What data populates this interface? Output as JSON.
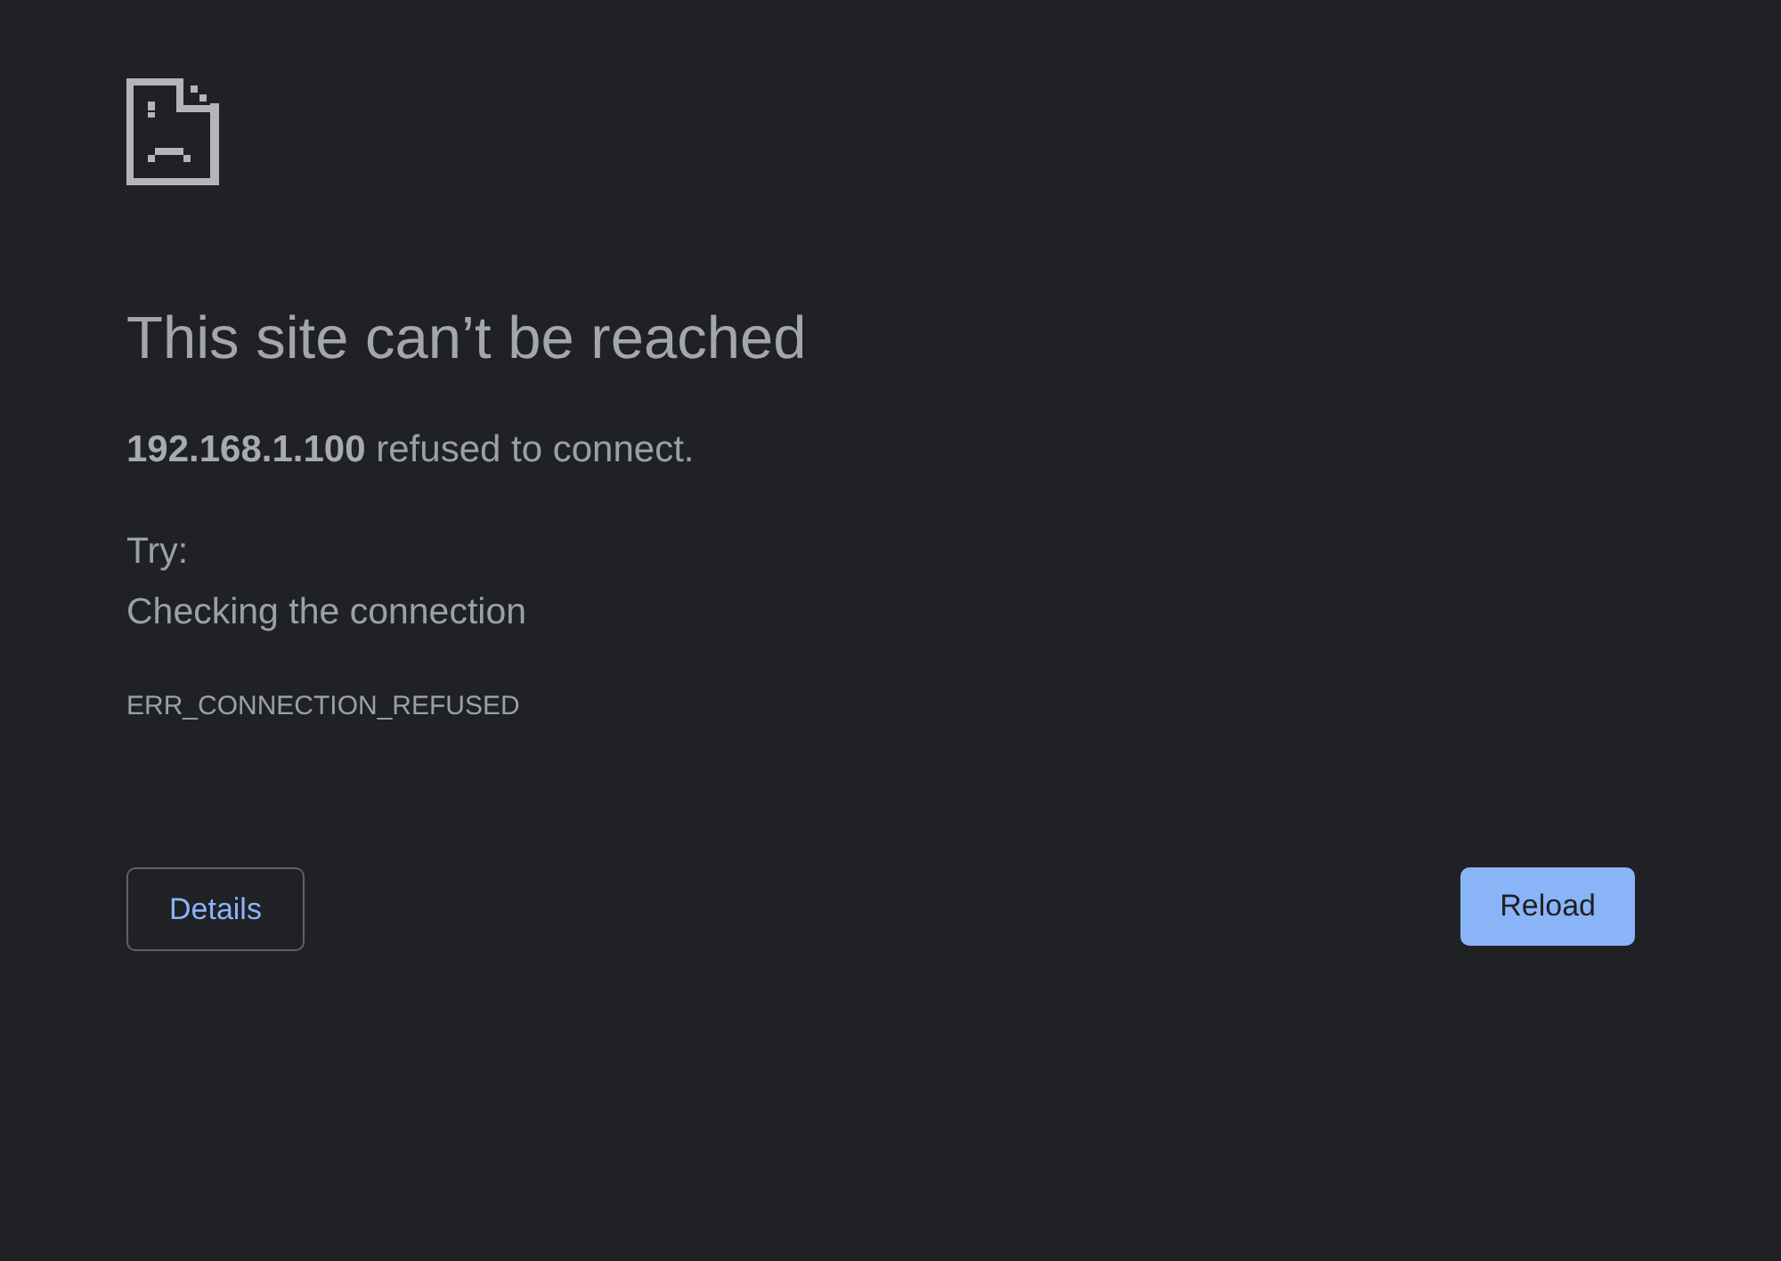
{
  "heading": "This site can’t be reached",
  "message": "**192.168.1.100** refused to connect.",
  "suggestions_heading": "Try:",
  "suggestions": [
    "Checking the connection"
  ],
  "error_code": "ERR_CONNECTION_REFUSED",
  "buttons": [
    {
      "label": "Details",
      "kind": "secondary"
    },
    {
      "label": "Reload",
      "kind": "primary"
    }
  ]
}
